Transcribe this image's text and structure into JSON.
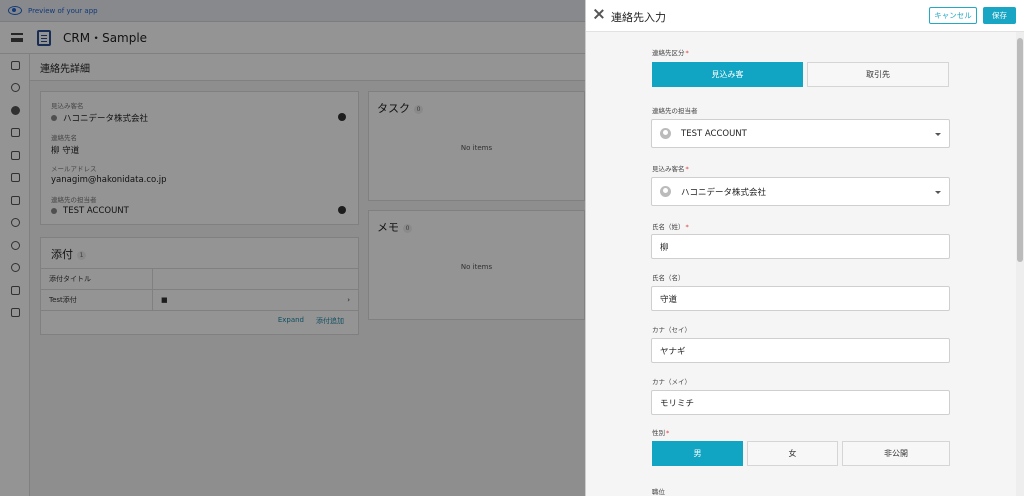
{
  "preview_bar": {
    "text": "Preview of your app"
  },
  "topbar": {
    "title": "CRM・Sample"
  },
  "breadcrumb": {
    "title": "連絡先詳細"
  },
  "detail_card": {
    "prospect_label": "見込み客名",
    "prospect_value": "ハコニデータ株式会社",
    "contact_label": "連絡先名",
    "contact_value": "柳 守道",
    "email_label": "メールアドレス",
    "email_value": "yanagim@hakonidata.co.jp",
    "owner_label": "連絡先の担当者",
    "owner_value": "TEST ACCOUNT"
  },
  "attachments": {
    "title": "添付",
    "count": "1",
    "header_label": "添付タイトル",
    "row_label": "Test添付",
    "expand_label": "Expand",
    "add_label": "添付追加"
  },
  "tasks": {
    "title": "タスク",
    "count": "0",
    "empty": "No items"
  },
  "memo": {
    "title": "メモ",
    "count": "0",
    "empty": "No items"
  },
  "dialog": {
    "title": "連絡先入力",
    "cancel_label": "キャンセル",
    "save_label": "保存",
    "fields": {
      "type_label": "連絡先区分",
      "type_options": [
        "見込み客",
        "取引先"
      ],
      "type_selected": "見込み客",
      "owner_label": "連絡先の担当者",
      "owner_value": "TEST ACCOUNT",
      "prospect_label": "見込み客名",
      "prospect_value": "ハコニデータ株式会社",
      "last_name_label": "氏名（姓）",
      "last_name_value": "柳",
      "first_name_label": "氏名（名）",
      "first_name_value": "守道",
      "kana_last_label": "カナ（セイ）",
      "kana_last_value": "ヤナギ",
      "kana_first_label": "カナ（メイ）",
      "kana_first_value": "モリミチ",
      "gender_label": "性別",
      "gender_options": [
        "男",
        "女",
        "非公開"
      ],
      "gender_selected": "男",
      "position_label": "職位"
    }
  },
  "colors": {
    "accent": "#12a5c3",
    "required": "#e53935"
  }
}
